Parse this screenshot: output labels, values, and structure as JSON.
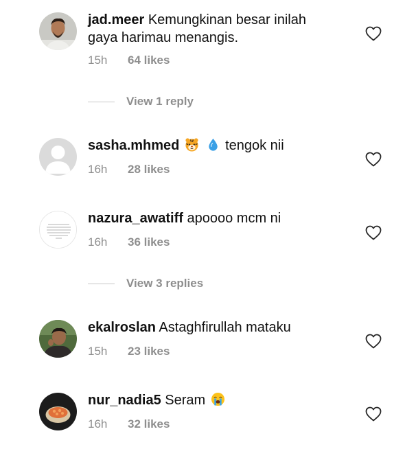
{
  "comments": [
    {
      "username": "jad.meer",
      "text": "Kemungkinan besar inilah",
      "text_line2": "gaya harimau menangis.",
      "time": "15h",
      "likes": "64 likes"
    },
    {
      "username": "sasha.mhmed",
      "text": "tengok nii",
      "emojis": [
        "tiger-face-icon",
        "droplet-icon"
      ],
      "time": "16h",
      "likes": "28 likes"
    },
    {
      "username": "nazura_awatiff",
      "text": "apoooo mcm ni",
      "time": "16h",
      "likes": "36 likes"
    },
    {
      "username": "ekalroslan",
      "text": "Astaghfirullah mataku",
      "time": "15h",
      "likes": "23 likes"
    },
    {
      "username": "nur_nadia5",
      "text": "Seram",
      "emojis": [
        "loudly-crying-face-icon"
      ],
      "time": "16h",
      "likes": "32 likes"
    }
  ],
  "view_replies": [
    {
      "label": "View 1 reply"
    },
    {
      "label": "View 3 replies"
    }
  ],
  "colors": {
    "text": "#111111",
    "meta": "#8e8e8e",
    "divider": "#c7c7c7",
    "placeholder_avatar": "#dbdbdb"
  }
}
